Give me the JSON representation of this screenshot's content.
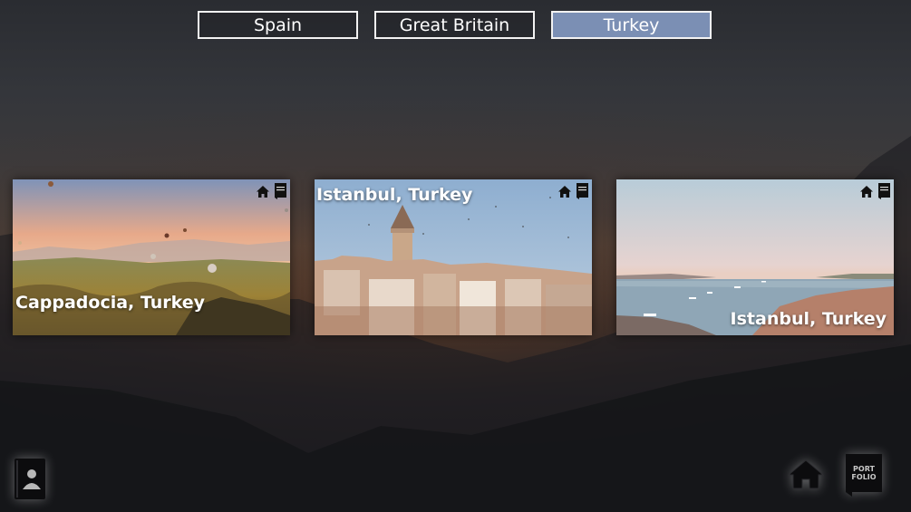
{
  "nav": {
    "tabs": [
      {
        "label": "Spain",
        "active": false
      },
      {
        "label": "Great Britain",
        "active": false
      },
      {
        "label": "Turkey",
        "active": true
      }
    ]
  },
  "gallery": {
    "cards": [
      {
        "title": "Cappadocia, Turkey"
      },
      {
        "title": "Istanbul, Turkey"
      },
      {
        "title": "Istanbul, Turkey"
      }
    ]
  },
  "portfolio_badge": {
    "line1": "PORT",
    "line2": "FOLIO"
  },
  "colors": {
    "active_tab": "#7b8fb4",
    "tab_border": "#f2f2f2",
    "background_dark": "#16171a"
  },
  "icons": {
    "card_home": "home-icon",
    "card_portfolio": "portfolio-icon",
    "contact": "contact-book-icon",
    "home": "home-icon",
    "portfolio": "portfolio-icon"
  }
}
